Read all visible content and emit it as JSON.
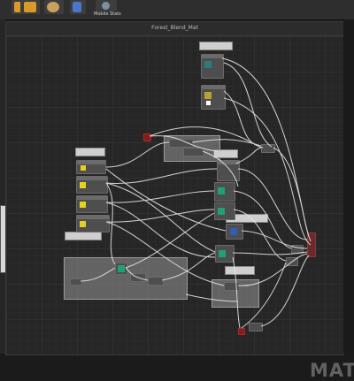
{
  "toolbar": {
    "buttons": [
      {
        "name": "toolbar-button-1",
        "icon": "tool-icon",
        "color": "#d99a2b"
      },
      {
        "name": "toolbar-button-2",
        "icon": "tool-icon",
        "color": "#d99a2b"
      },
      {
        "name": "toolbar-button-3",
        "icon": "settings-icon",
        "color": "#c9a060"
      },
      {
        "name": "toolbar-button-4",
        "icon": "blue-box-icon",
        "color": "#4a76c9"
      },
      {
        "name": "toolbar-button-5",
        "icon": "person-icon",
        "color": "#7b8fa3"
      }
    ],
    "last_label": "Mobile Stats"
  },
  "graph": {
    "title": "Forest_Blend_Mat"
  },
  "watermark": "MATE",
  "colors": {
    "background": "#262626",
    "node": "#4e4e4e",
    "wire": "#e6e6e6",
    "output_node": "#6b2a2a",
    "accent_teal": "#1ea07a",
    "accent_yellow": "#e8d022"
  }
}
